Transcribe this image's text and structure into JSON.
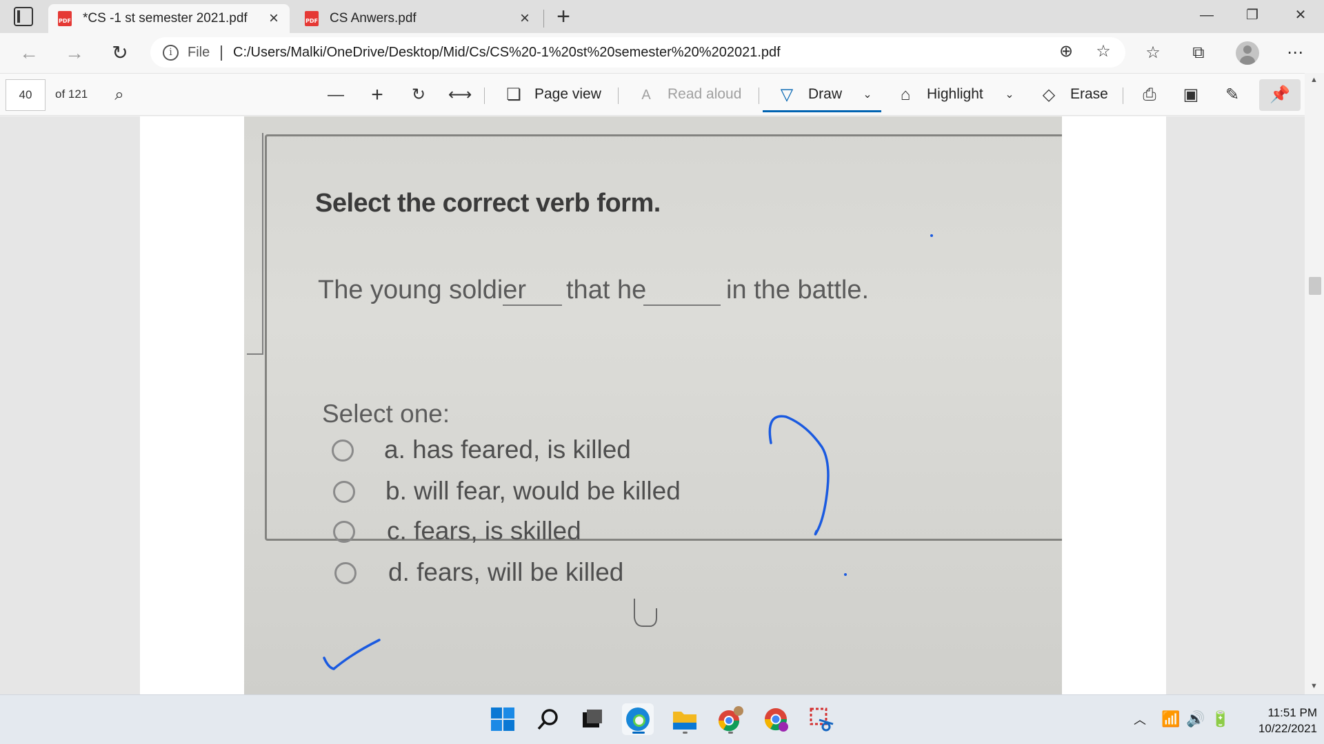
{
  "browser": {
    "tabs": [
      {
        "title": "*CS -1 st semester 2021.pdf",
        "active": true,
        "icon": "pdf-icon"
      },
      {
        "title": "CS Anwers.pdf",
        "active": false,
        "icon": "pdf-icon"
      }
    ],
    "address": {
      "scheme_label": "File",
      "url": "C:/Users/Malki/OneDrive/Desktop/Mid/Cs/CS%20-1%20st%20semester%20%202021.pdf"
    }
  },
  "pdf_toolbar": {
    "page_number": "40",
    "page_total": "of 121",
    "page_view_label": "Page view",
    "read_aloud_label": "Read aloud",
    "draw_label": "Draw",
    "highlight_label": "Highlight",
    "erase_label": "Erase",
    "accent_color": "#0063b1"
  },
  "document": {
    "question_title": "Select the correct verb form.",
    "sentence": [
      "The young soldier",
      "that he",
      "in the battle."
    ],
    "select_one": "Select one:",
    "options": [
      "a. has feared, is killed",
      "b. will fear, would be killed",
      "c. fears, is skilled",
      "d. fears, will be killed"
    ],
    "ink_color": "#1a5ae0"
  },
  "taskbar": {
    "time": "11:51 PM",
    "date": "10/22/2021"
  }
}
